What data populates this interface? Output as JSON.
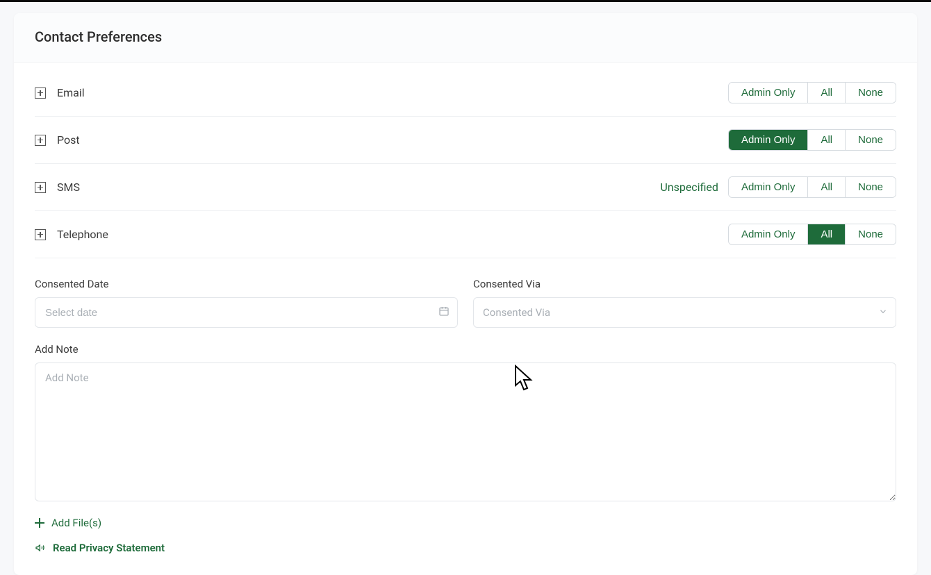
{
  "header": {
    "title": "Contact Preferences"
  },
  "options": {
    "admin_only": "Admin Only",
    "all": "All",
    "none": "None"
  },
  "prefs": [
    {
      "label": "Email",
      "status": "",
      "selected": ""
    },
    {
      "label": "Post",
      "status": "",
      "selected": "admin_only"
    },
    {
      "label": "SMS",
      "status": "Unspecified",
      "selected": ""
    },
    {
      "label": "Telephone",
      "status": "",
      "selected": "all"
    }
  ],
  "consented_date": {
    "label": "Consented Date",
    "placeholder": "Select date",
    "value": ""
  },
  "consented_via": {
    "label": "Consented Via",
    "placeholder": "Consented Via",
    "value": ""
  },
  "note": {
    "label": "Add Note",
    "placeholder": "Add Note",
    "value": ""
  },
  "add_files": {
    "label": "Add File(s)"
  },
  "privacy": {
    "label": "Read Privacy Statement"
  }
}
